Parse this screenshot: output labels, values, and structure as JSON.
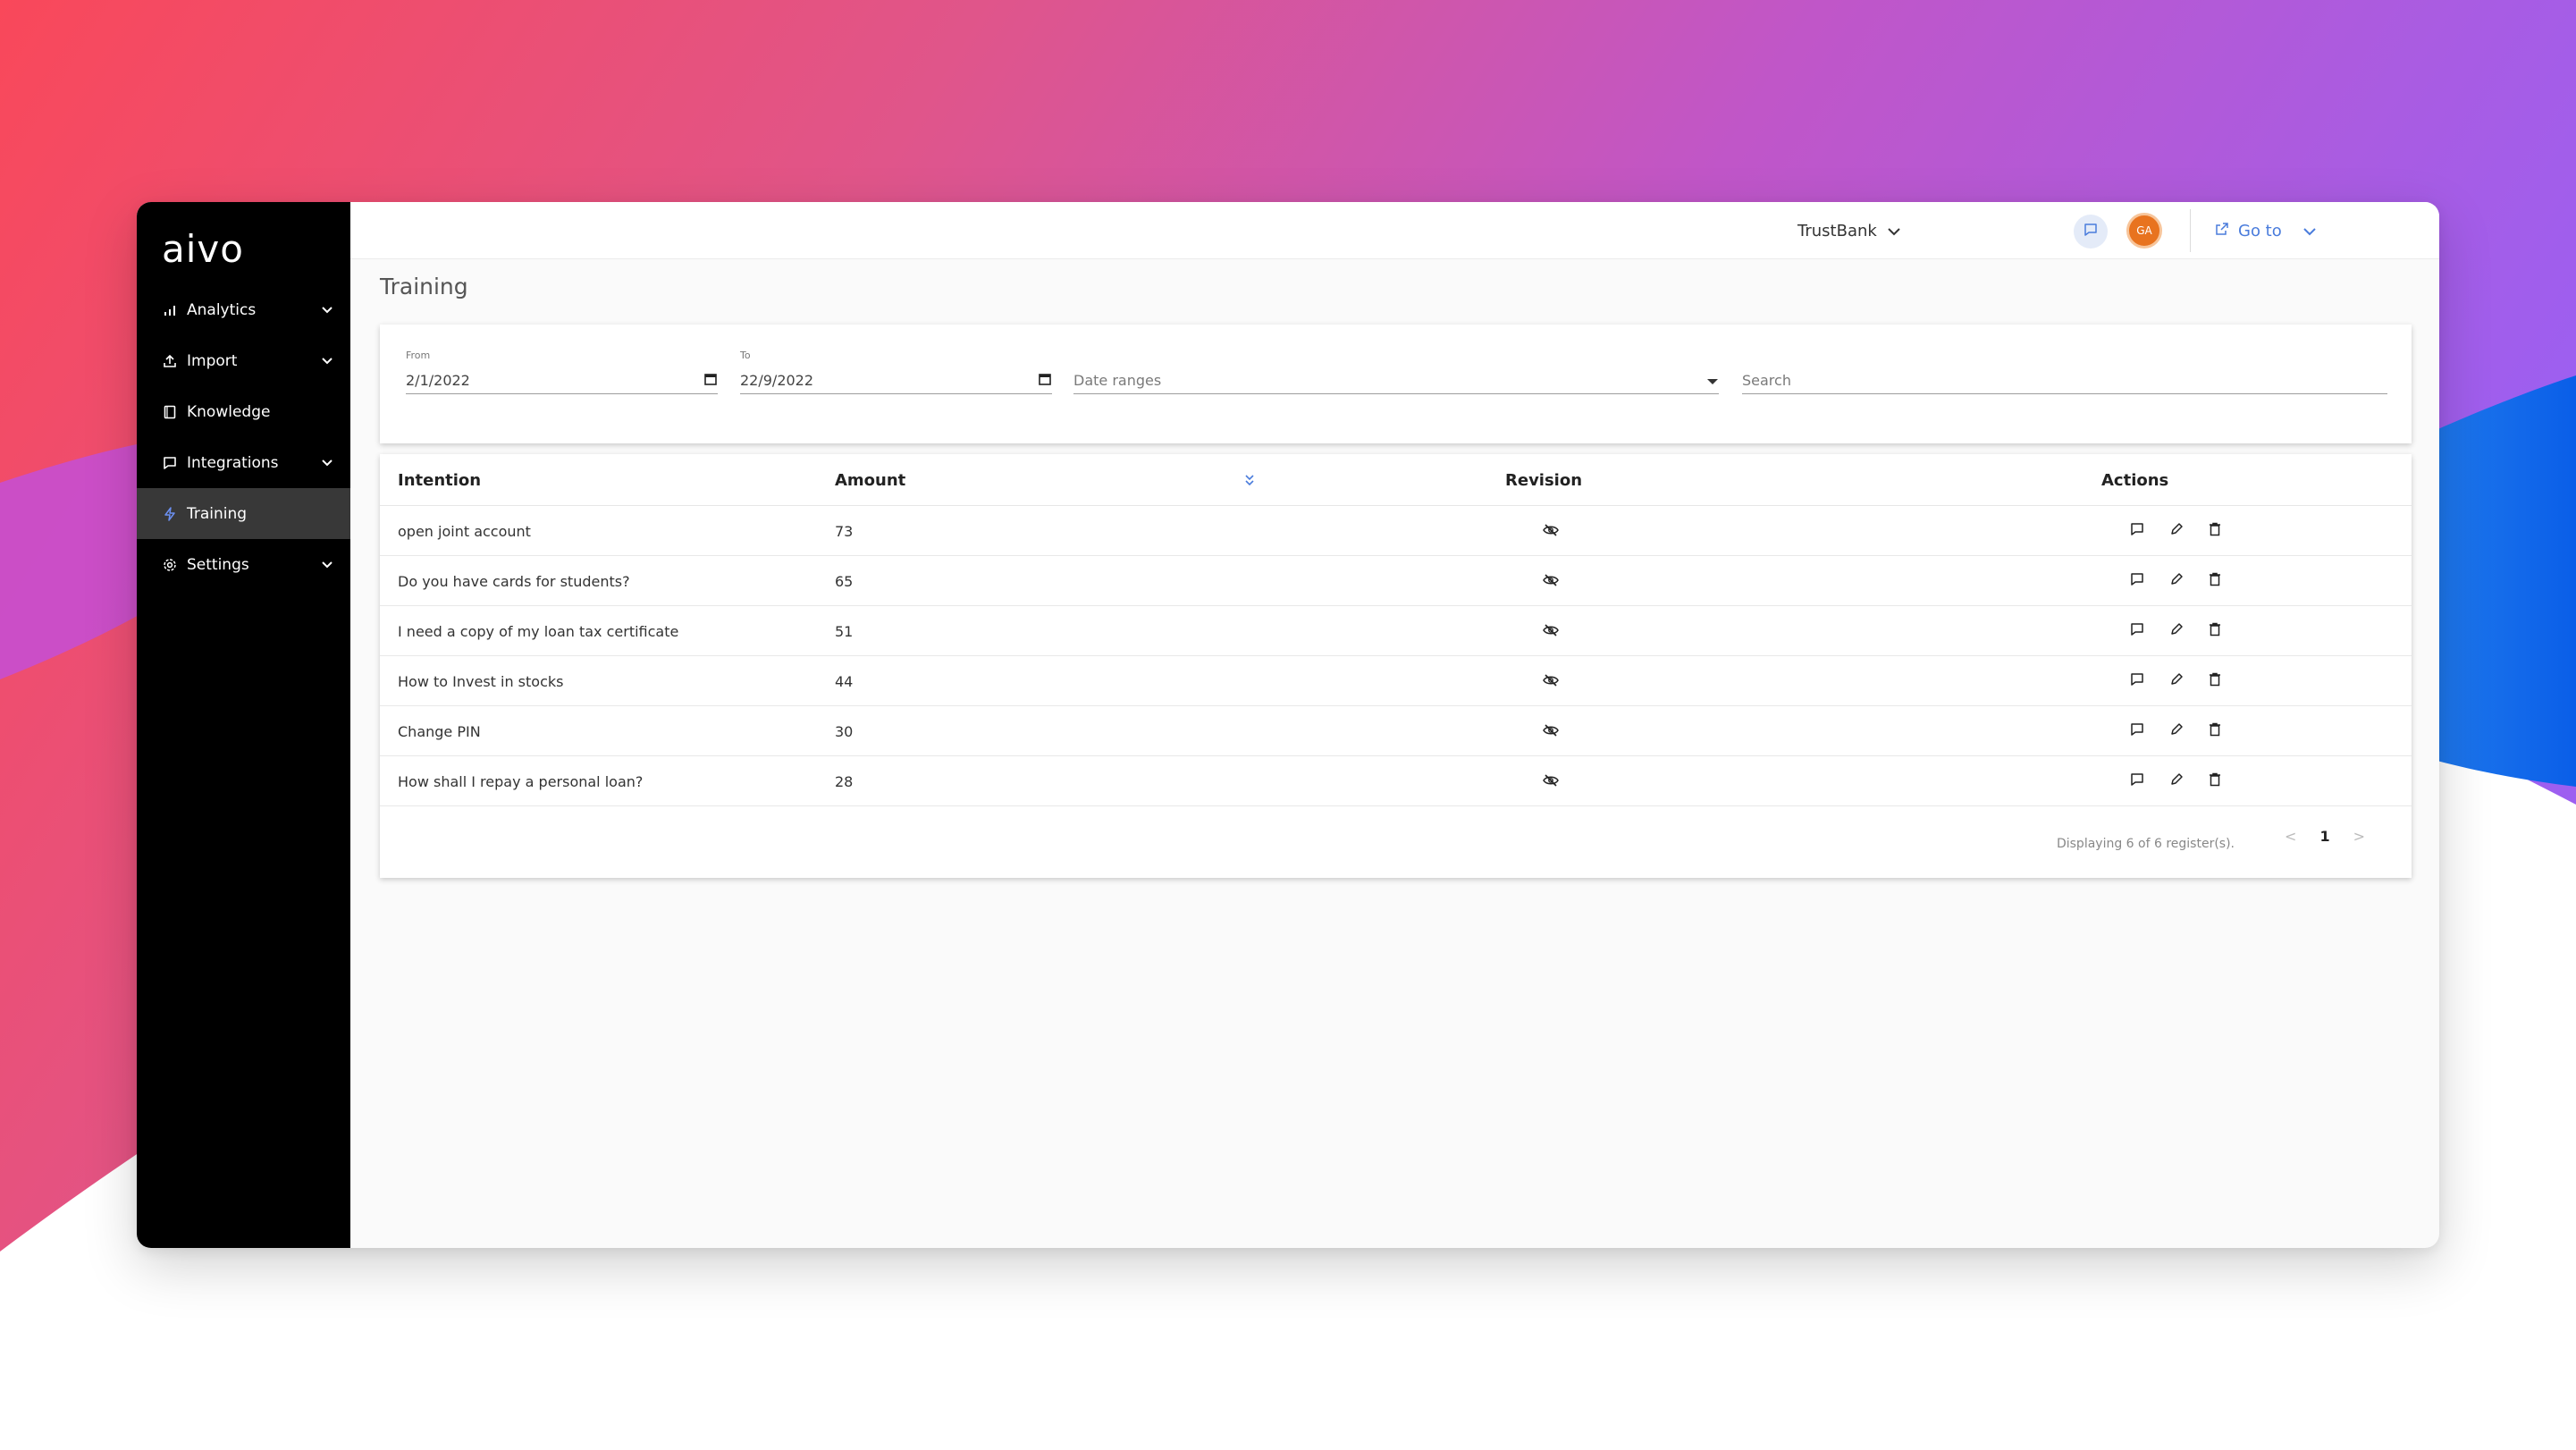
{
  "brand": {
    "logo_text": "aivo"
  },
  "sidebar": {
    "items": [
      {
        "label": "Analytics",
        "icon": "bar-chart-icon",
        "has_submenu": true,
        "active": false
      },
      {
        "label": "Import",
        "icon": "upload-icon",
        "has_submenu": true,
        "active": false
      },
      {
        "label": "Knowledge",
        "icon": "book-icon",
        "has_submenu": false,
        "active": false
      },
      {
        "label": "Integrations",
        "icon": "chat-bubble-icon",
        "has_submenu": true,
        "active": false
      },
      {
        "label": "Training",
        "icon": "lightning-icon",
        "has_submenu": false,
        "active": true
      },
      {
        "label": "Settings",
        "icon": "gear-icon",
        "has_submenu": true,
        "active": false
      }
    ]
  },
  "header": {
    "organization": "TrustBank",
    "avatar_initials": "GA",
    "goto_label": "Go to",
    "accent_color": "#4a7cdc",
    "avatar_color": "#e8731f"
  },
  "page": {
    "title": "Training"
  },
  "filters": {
    "from_label": "From",
    "from_value": "2/1/2022",
    "to_label": "To",
    "to_value": "22/9/2022",
    "date_ranges_placeholder": "Date ranges",
    "search_placeholder": "Search"
  },
  "table": {
    "columns": {
      "intention": "Intention",
      "amount": "Amount",
      "revision": "Revision",
      "actions": "Actions"
    },
    "rows": [
      {
        "intention": "open joint account",
        "amount": "73"
      },
      {
        "intention": "Do you have cards for students?",
        "amount": "65"
      },
      {
        "intention": "I need a copy of my loan tax certificate",
        "amount": "51"
      },
      {
        "intention": "How to Invest in stocks",
        "amount": "44"
      },
      {
        "intention": "Change PIN",
        "amount": "30"
      },
      {
        "intention": "How shall I repay a personal loan?",
        "amount": "28"
      }
    ],
    "footer": "Displaying 6 of 6 register(s).",
    "current_page": "1",
    "prev_symbol": "<",
    "next_symbol": ">"
  }
}
